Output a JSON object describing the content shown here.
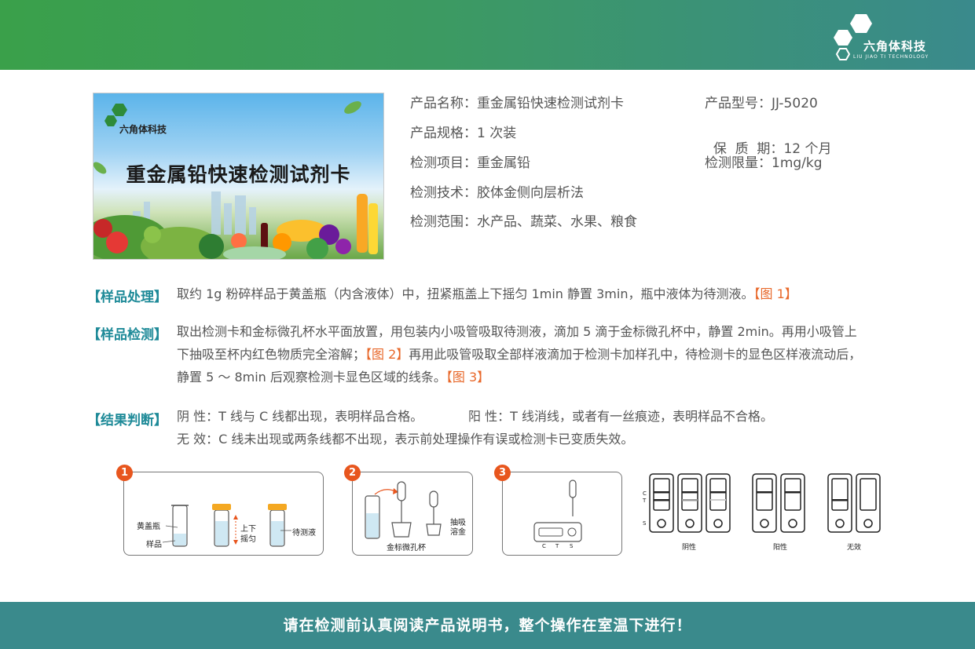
{
  "header": {
    "brand_name": "六角体科技",
    "brand_sub": "LIU JIAO TI TECHNOLOGY"
  },
  "banner": {
    "title": "重金属铅快速检测试剂卡",
    "brand_name": "六角体科技",
    "brand_sub": "LIU JIAO TI TECHNOLOGY"
  },
  "product": {
    "name_label": "产品名称：",
    "name": "重金属铅快速检测试剂卡",
    "model_label": "产品型号：",
    "model": "JJ-5020",
    "spec_label": "产品规格：",
    "spec": "1 次装",
    "shelf_label": "保  质  期：",
    "shelf": "12 个月",
    "item_label": "检测项目：",
    "item": "重金属铅",
    "limit_label": "检测限量：",
    "limit": "1mg/kg",
    "tech_label": "检测技术：",
    "tech": "胶体金侧向层析法",
    "scope_label": "检测范围：",
    "scope": "水产品、蔬菜、水果、粮食"
  },
  "sections": {
    "sample_prep": {
      "label": "【样品处理】",
      "text": "取约 1g 粉碎样品于黄盖瓶（内含液体）中，扭紧瓶盖上下摇匀 1min 静置 3min，瓶中液体为待测液。",
      "ref": "【图 1】"
    },
    "sample_test": {
      "label": "【样品检测】",
      "line1": "取出检测卡和金标微孔杯水平面放置，用包装内小吸管吸取待测液，滴加 5 滴于金标微孔杯中，静置 2min。再用小吸管上",
      "line2a": "下抽吸至杯内红色物质完全溶解；",
      "ref2": "【图 2】",
      "line2b": "再用此吸管吸取全部样液滴加于检测卡加样孔中，待检测卡的显色区样液流动后，",
      "line3": "静置 5 ～ 8min 后观察检测卡显色区域的线条。",
      "ref3": "【图 3】"
    },
    "result": {
      "label": "【结果判断】",
      "negative": "阴 性：T 线与 C 线都出现，表明样品合格。",
      "positive": "阳 性：T 线消线，或者有一丝痕迹，表明样品不合格。",
      "invalid": "无 效：C 线未出现或两条线都不出现，表示前处理操作有误或检测卡已变质失效。"
    }
  },
  "figures": {
    "fig1": {
      "num": "1",
      "bottle_label": "黄盖瓶",
      "sample_label": "样品",
      "shake_label1": "上下",
      "shake_label2": "摇匀",
      "liquid_label": "待测液"
    },
    "fig2": {
      "num": "2",
      "cup_label": "金标微孔杯",
      "draw_label1": "抽吸",
      "draw_label2": "溶金"
    },
    "fig3": {
      "num": "3",
      "c_mark": "C",
      "t_mark": "T",
      "s_mark": "S"
    },
    "results": {
      "c": "C",
      "t": "T",
      "s": "S",
      "negative": "阴性",
      "positive": "阳性",
      "invalid": "无效"
    }
  },
  "footer": {
    "text": "请在检测前认真阅读产品说明书，整个操作在室温下进行！"
  },
  "colors": {
    "header_start": "#3aa04a",
    "header_end": "#3a8a8c",
    "accent_teal": "#1e8a98",
    "ref_orange": "#e8682a",
    "badge": "#e8561e"
  }
}
